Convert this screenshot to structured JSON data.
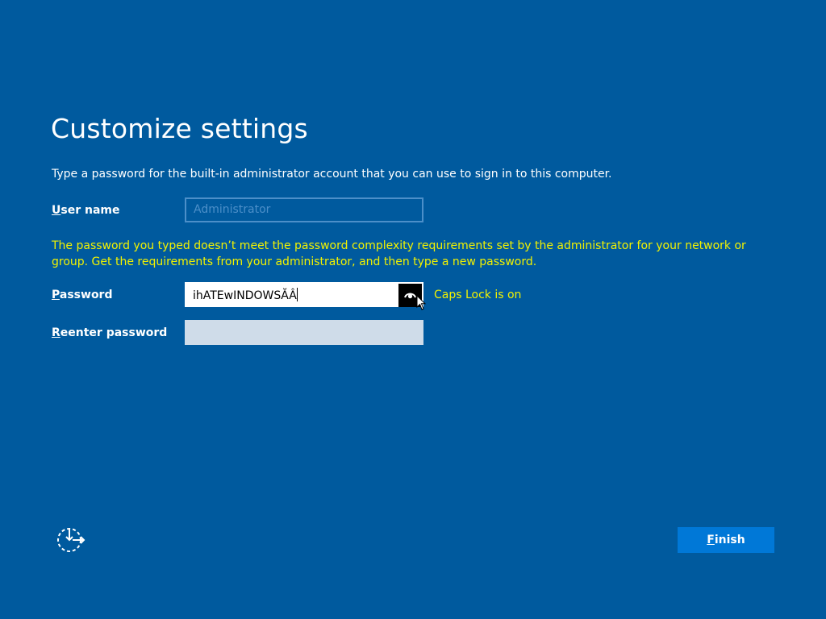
{
  "page": {
    "title": "Customize settings",
    "subtitle": "Type a password for the built-in administrator account that you can use to sign in to this computer."
  },
  "fields": {
    "username": {
      "label_access_key": "U",
      "label_rest": "ser name",
      "placeholder": "Administrator",
      "value": ""
    },
    "password": {
      "label_access_key": "P",
      "label_rest": "assword",
      "value": "ihATEwINDOWSĂÂ"
    },
    "reenter": {
      "label_access_key": "R",
      "label_rest": "eenter password",
      "value": ""
    }
  },
  "warning": "The password you typed doesn’t meet the password complexity requirements set by the administrator for your network or group. Get the requirements from your administrator, and then type a new password.",
  "caps_lock": "Caps Lock is on",
  "finish": {
    "access_key": "F",
    "rest": "inish"
  },
  "icons": {
    "reveal": "eye-icon",
    "accessibility": "ease-of-access-icon",
    "cursor": "mouse-pointer-icon"
  },
  "colors": {
    "background": "#005a9e",
    "warning_text": "#f2f200",
    "button": "#0078d7",
    "field_border": "#4c8fc9"
  }
}
